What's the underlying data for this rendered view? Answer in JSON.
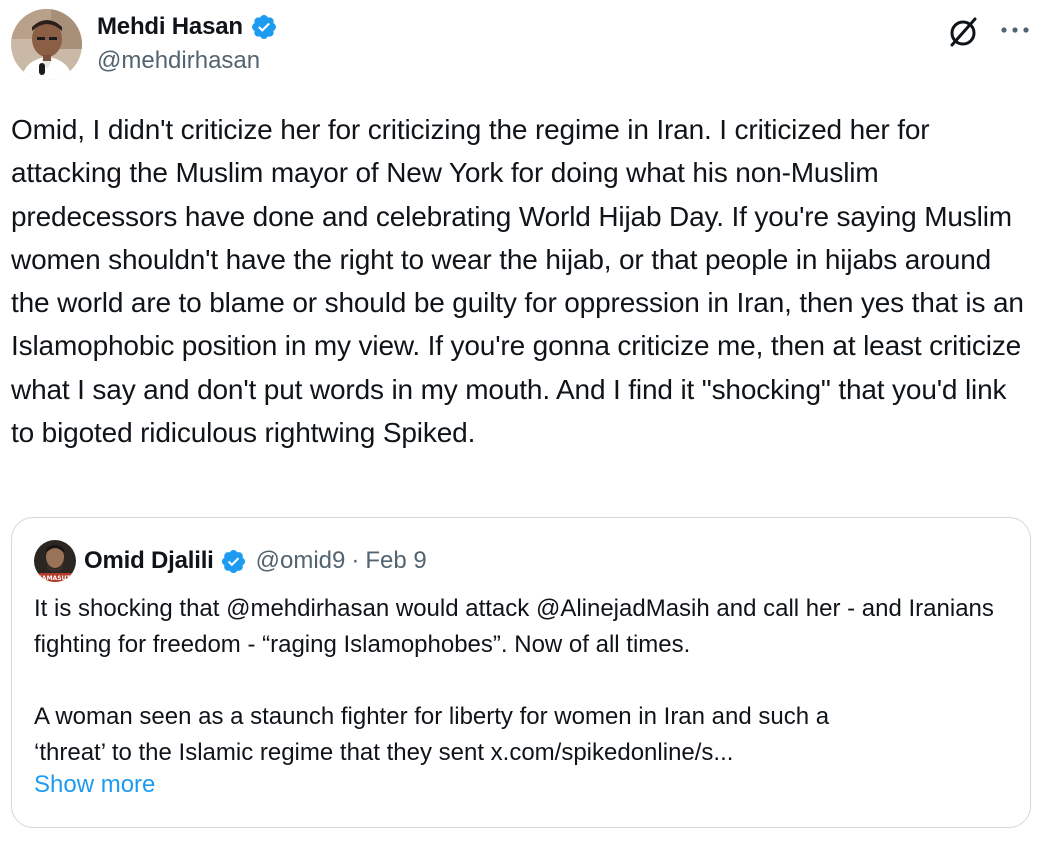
{
  "author": {
    "name": "Mehdi Hasan",
    "handle": "@mehdirhasan",
    "verified": true,
    "avatar_icon": "user-avatar-photo"
  },
  "header_actions": {
    "grok_icon": "grok-slash-circle-icon",
    "more_icon": "more-horizontal-icon"
  },
  "tweet": {
    "text": "Omid, I didn't criticize her for criticizing the regime in Iran. I criticized her for attacking the Muslim mayor of New York for doing what his non-Muslim predecessors have done and celebrating World Hijab Day. If you're saying Muslim women shouldn't have the right to wear the hijab, or that people in hijabs around the world are to blame or should be guilty for oppression in Iran, then yes that is an Islamophobic position in my view. If you're gonna criticize me, then at least criticize what I say and don't put words in my mouth. And I find it \"shocking\" that you'd link to bigoted ridiculous rightwing Spiked."
  },
  "quote": {
    "name": "Omid Djalili",
    "handle": "@omid9",
    "separator": "·",
    "date": "Feb 9",
    "verified": true,
    "para1": "It is shocking that @mehdirhasan would attack @AlinejadMasih and call her - and Iranians fighting for freedom - “raging Islamophobes”. Now of all times.",
    "para2_line1": "A woman seen as a staunch fighter for liberty for women in Iran and such a",
    "para2_line2": "‘threat’ to the Islamic regime that they sent x.com/spikedonline/s...",
    "show_more": "Show more",
    "avatar_caption": "KAMASUTI"
  },
  "colors": {
    "text": "#0f1419",
    "secondary": "#536471",
    "link": "#1d9bf0",
    "border": "#cfd9de",
    "verified": "#1d9bf0"
  }
}
